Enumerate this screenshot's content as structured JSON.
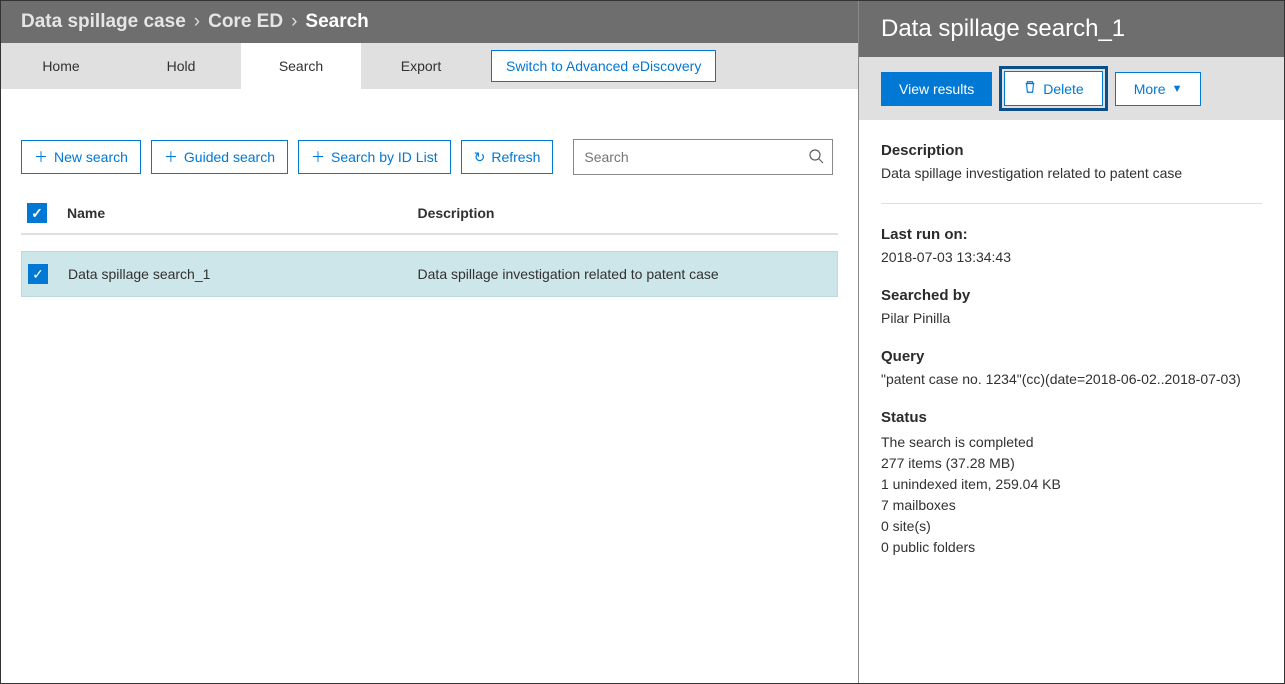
{
  "breadcrumb": {
    "items": [
      "Data spillage case",
      "Core ED",
      "Search"
    ]
  },
  "tabs": {
    "items": [
      "Home",
      "Hold",
      "Search",
      "Export"
    ],
    "active": "Search",
    "advanced_link": "Switch to Advanced eDiscovery"
  },
  "toolbar": {
    "new_search": "New search",
    "guided_search": "Guided search",
    "search_by_id": "Search by ID List",
    "refresh": "Refresh",
    "search_placeholder": "Search"
  },
  "table": {
    "headers": {
      "name": "Name",
      "description": "Description"
    },
    "rows": [
      {
        "name": "Data spillage search_1",
        "description": "Data spillage investigation related to patent case",
        "checked": true
      }
    ],
    "header_checked": true
  },
  "panel": {
    "title": "Data spillage search_1",
    "actions": {
      "view_results": "View results",
      "delete": "Delete",
      "more": "More"
    },
    "description_label": "Description",
    "description_value": "Data spillage investigation related to patent case",
    "last_run_label": "Last run on:",
    "last_run_value": "2018-07-03 13:34:43",
    "searched_by_label": "Searched by",
    "searched_by_value": "Pilar Pinilla",
    "query_label": "Query",
    "query_value": "\"patent case no. 1234\"(cc)(date=2018-06-02..2018-07-03)",
    "status_label": "Status",
    "status_lines": [
      "The search is completed",
      "277 items (37.28 MB)",
      "1 unindexed item, 259.04 KB",
      "7 mailboxes",
      "0 site(s)",
      "0 public folders"
    ]
  }
}
